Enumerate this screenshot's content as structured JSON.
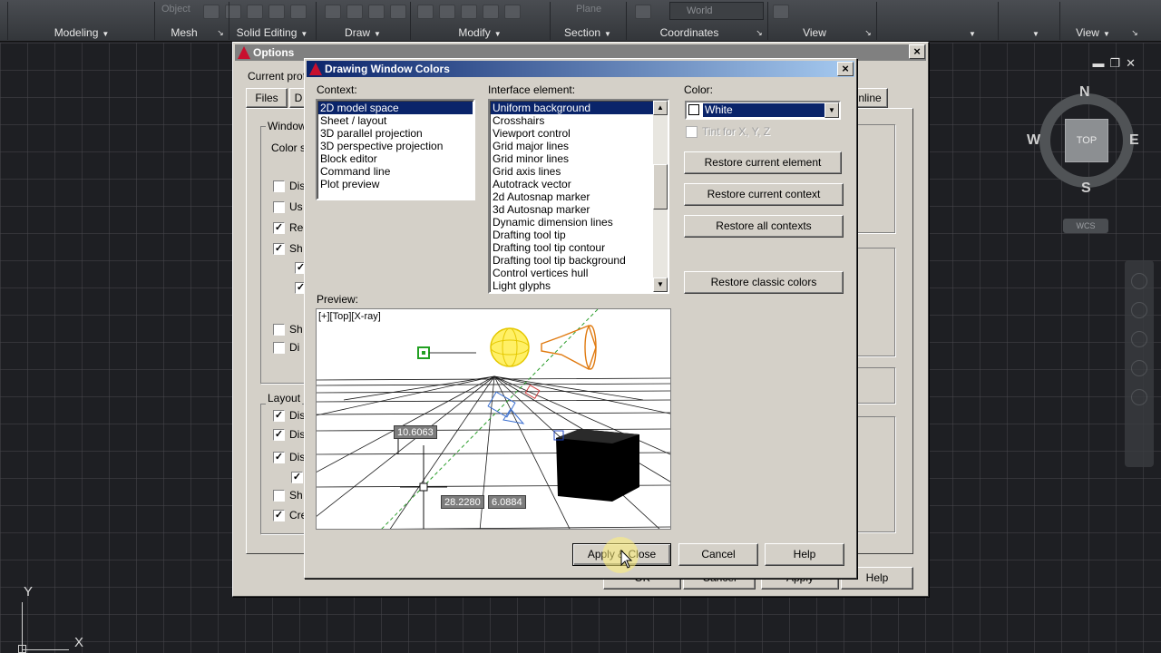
{
  "ribbon": {
    "panels": [
      {
        "label": "Modeling"
      },
      {
        "label": "Mesh"
      },
      {
        "label": "Solid Editing"
      },
      {
        "label": "Draw"
      },
      {
        "label": "Modify"
      },
      {
        "label": "Section"
      },
      {
        "label": "Coordinates"
      },
      {
        "label": "View"
      },
      {
        "label": "View"
      }
    ],
    "object_label": "Object",
    "plane_label": "Plane",
    "world_select": "World"
  },
  "viewcube": {
    "top": "TOP",
    "north": "N",
    "south": "S",
    "east": "E",
    "west": "W",
    "wcs": "WCS"
  },
  "ucs": {
    "x": "X",
    "y": "Y"
  },
  "options_dialog": {
    "title": "Options",
    "current_profile_label": "Current profi",
    "tabs": [
      "Files",
      "D",
      "nline"
    ],
    "window_group": "Window",
    "color_scheme_label": "Color s",
    "checkbox_labels": [
      "Dis",
      "Us",
      "Re",
      "Sh",
      "",
      "",
      "Sh",
      "Di"
    ],
    "checkbox_states": [
      false,
      false,
      true,
      true,
      true,
      true,
      false,
      false
    ],
    "layout_group": "Layout",
    "layout_labels": [
      "Dis",
      "Dis",
      "Dis",
      "",
      "Sh",
      "Cre"
    ],
    "layout_states": [
      true,
      true,
      true,
      true,
      false,
      true
    ],
    "footer_buttons": [
      "OK",
      "Cancel",
      "Apply",
      "Help"
    ]
  },
  "colors_dialog": {
    "title": "Drawing Window Colors",
    "context_label": "Context:",
    "contexts": [
      "2D model space",
      "Sheet / layout",
      "3D parallel projection",
      "3D perspective projection",
      "Block editor",
      "Command line",
      "Plot preview"
    ],
    "selected_context": 0,
    "interface_label": "Interface element:",
    "interface_elements": [
      "Uniform background",
      "Crosshairs",
      "Viewport control",
      "Grid major lines",
      "Grid minor lines",
      "Grid axis lines",
      "Autotrack vector",
      "2d Autosnap marker",
      "3d Autosnap marker",
      "Dynamic dimension lines",
      "Drafting tool tip",
      "Drafting tool tip contour",
      "Drafting tool tip background",
      "Control vertices hull",
      "Light glyphs"
    ],
    "selected_element": 0,
    "color_label": "Color:",
    "color_value": "White",
    "tint_label": "Tint for X, Y, Z",
    "buttons": {
      "restore_element": "Restore current element",
      "restore_context": "Restore current context",
      "restore_all": "Restore all contexts",
      "restore_classic": "Restore classic colors",
      "apply_close": "Apply & Close",
      "cancel": "Cancel",
      "help": "Help"
    },
    "preview_label": "Preview:",
    "preview": {
      "viewport_label": "[+][Top][X-ray]",
      "dim1": "10.6063",
      "dim2": "28.2280",
      "dim3": "6.0884"
    }
  },
  "colors": {
    "selection": "#0a246a",
    "dialog_bg": "#d4d0c8",
    "titlebar_active": "#0a246a",
    "titlebar_inactive": "#808080"
  }
}
